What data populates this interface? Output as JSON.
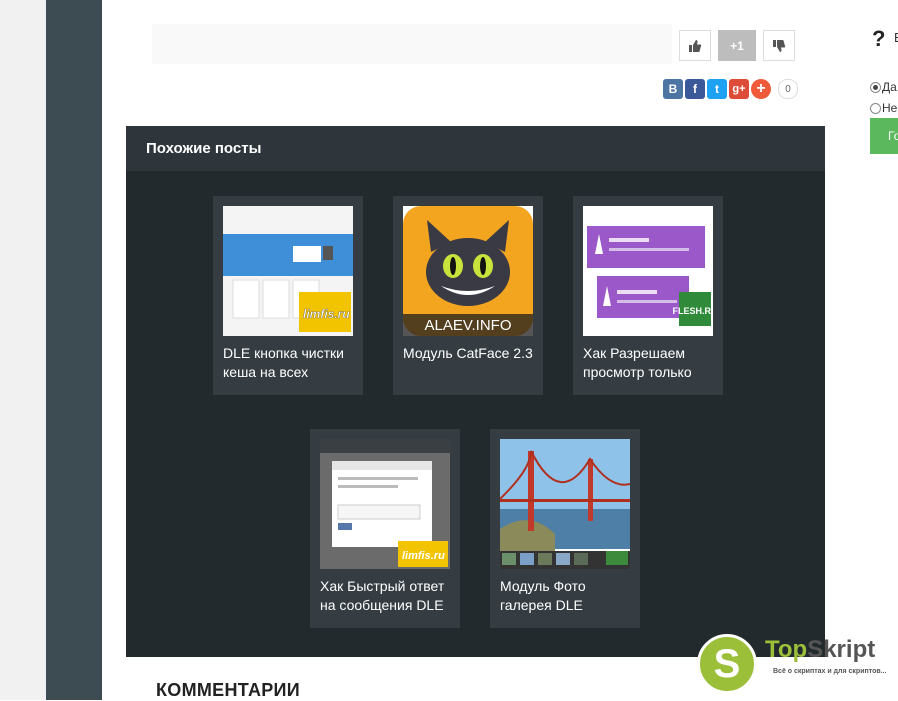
{
  "rating": {
    "score": "+1"
  },
  "share": {
    "vk": "В",
    "fb": "f",
    "tw": "t",
    "gp": "g+",
    "more": "+",
    "count": "0"
  },
  "poll": {
    "icon": "?",
    "question_cut": "В",
    "options": [
      {
        "label": "Да",
        "selected": true
      },
      {
        "label": "Не",
        "selected": false
      }
    ],
    "button": "Го"
  },
  "related": {
    "heading": "Похожие посты",
    "posts": [
      {
        "title": "DLE кнопка чистки кеша на всех",
        "thumb": "screenshot-thumb",
        "watermark": "limfis.ru"
      },
      {
        "title": "Модуль CatFace 2.3",
        "thumb": "cat-thumb",
        "watermark": "ALAEV.INFO"
      },
      {
        "title": "Хак Разрешаем просмотр только",
        "thumb": "info-thumb",
        "watermark": "FLESH.RU"
      },
      {
        "title": "Хак Быстрый ответ на сообщения DLE",
        "thumb": "dialog-thumb",
        "watermark": "limfis.ru"
      },
      {
        "title": "Модуль Фото галерея DLE",
        "thumb": "bridge-thumb",
        "watermark": ""
      }
    ]
  },
  "comments": {
    "title": "КОММЕНТАРИИ"
  },
  "brand": {
    "letter": "S",
    "name_a": "Top",
    "name_b": "Skript",
    "tagline": "Всё о скриптах и для скриптов..."
  },
  "colors": {
    "sidebar": "#3d4b52",
    "panel": "#232a2e",
    "card": "#353d42",
    "accent": "#9cbf3a"
  }
}
